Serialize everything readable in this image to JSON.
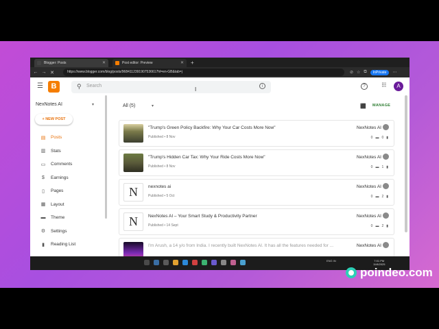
{
  "browser": {
    "tabs": [
      {
        "title": "Blogger: Posts",
        "active": true
      },
      {
        "title": "Post editor: Preview",
        "active": false
      }
    ],
    "new_tab_glyph": "+",
    "close_glyph": "✕",
    "url": "https://www.blogger.com/blog/posts/9684112391907536617hl=en-GB&tab=j",
    "inprivate_label": "InPrivate"
  },
  "header": {
    "search_placeholder": "Search"
  },
  "sidebar": {
    "blog_name": "NexNotes AI",
    "new_post_label": "+ NEW POST",
    "items": [
      {
        "label": "Posts",
        "icon": "posts-icon",
        "active": true
      },
      {
        "label": "Stats",
        "icon": "stats-icon",
        "active": false
      },
      {
        "label": "Comments",
        "icon": "comments-icon",
        "active": false
      },
      {
        "label": "Earnings",
        "icon": "earnings-icon",
        "active": false
      },
      {
        "label": "Pages",
        "icon": "pages-icon",
        "active": false
      },
      {
        "label": "Layout",
        "icon": "layout-icon",
        "active": false
      },
      {
        "label": "Theme",
        "icon": "theme-icon",
        "active": false
      },
      {
        "label": "Settings",
        "icon": "settings-icon",
        "active": false
      },
      {
        "label": "Reading List",
        "icon": "reading-list-icon",
        "active": false
      }
    ]
  },
  "main": {
    "filter_label": "All (5)",
    "manage_label": "MANAGE",
    "posts": [
      {
        "title": "\"Trump's Green Policy Backfire: Why Your Car Costs More Now\"",
        "meta": "Published • 8 Nov",
        "author": "NexNotes AI",
        "comments": "0",
        "views": "0",
        "thumb": "image"
      },
      {
        "title": "\"Trump's Hidden Car Tax: Why Your Ride Costs More Now\"",
        "meta": "Published • 8 Nov",
        "author": "NexNotes AI",
        "comments": "0",
        "views": "1",
        "thumb": "image"
      },
      {
        "title": "nexnotes ai",
        "meta": "Published • 5 Oct",
        "author": "NexNotes AI",
        "comments": "0",
        "views": "2",
        "thumb": "N"
      },
      {
        "title": "NexNotes AI – Your Smart Study & Productivity Partner",
        "meta": "Published • 14 Sept",
        "author": "NexNotes AI",
        "comments": "0",
        "views": "2",
        "thumb": "N"
      },
      {
        "title": "I'm Arush, a 14 y/o from India. I recently built NexNotes AI. It has all the features needed for ...",
        "meta": "",
        "author": "NexNotes AI",
        "comments": "",
        "views": "",
        "thumb": "image"
      }
    ]
  },
  "taskbar": {
    "tray_lang": "ENG\nIN",
    "time": "7:01 PM",
    "date": "11/8/2025"
  },
  "watermark": {
    "text": "poindeo.com"
  },
  "colors": {
    "accent": "#e8710a",
    "brand": "#f57d00",
    "manage": "#2e7d32",
    "avatar": "#6a1b9a"
  }
}
